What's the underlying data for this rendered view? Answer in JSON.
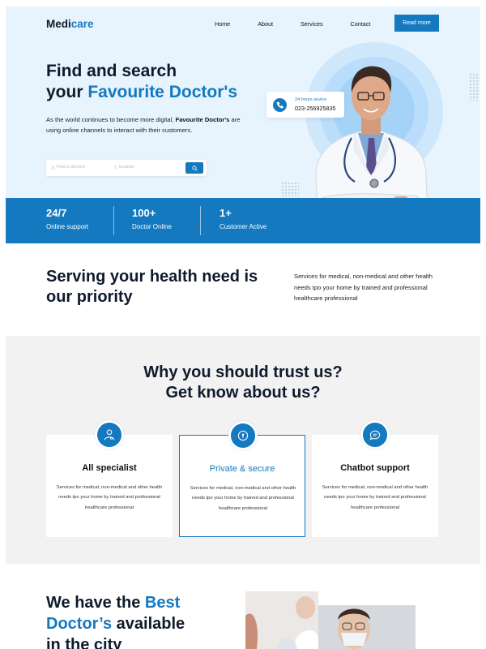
{
  "brand": {
    "name_part1": "Medi",
    "name_part2": "care"
  },
  "nav": {
    "items": [
      "Home",
      "About",
      "Services",
      "Contact"
    ],
    "cta": "Read more"
  },
  "hero": {
    "title_line1": "Find and search",
    "title_line2_plain": "your ",
    "title_line2_accent": "Favourite Doctor's",
    "desc_part1": "As the world continues to become more digital, ",
    "desc_bold": "Favourite Doctor's",
    "desc_part2": " are using online channels to interact with their customers.",
    "search": {
      "doctor_placeholder": "Find a doctors",
      "location_placeholder": "location"
    }
  },
  "support": {
    "title": "24 hours sevice",
    "phone": "023-256925835"
  },
  "stats": [
    {
      "value": "24/7",
      "label": "Online support"
    },
    {
      "value": "100+",
      "label": "Doctor Online"
    },
    {
      "value": "1+",
      "label": "Customer Active"
    }
  ],
  "serving": {
    "title": "Serving your health need is our priority",
    "desc": "Services for medical, non-medical and other health needs tpo your home by trained and professional healthcare professional"
  },
  "trust": {
    "title_line1": "Why you should trust us?",
    "title_line2": "Get know about us?",
    "cards": [
      {
        "title": "All specialist",
        "desc": "Services for medical, non-medical and other health needs tpo your home by trained and professional healthcare professional",
        "icon": "doctor-icon"
      },
      {
        "title": "Private & secure",
        "desc": "Services for medical, non-medical and other health needs tpo your home by trained and professional healthcare professional",
        "icon": "lock-icon"
      },
      {
        "title": "Chatbot support",
        "desc": "Services for medical, non-medical and other health needs tpo your home by trained and professional healthcare professional",
        "icon": "chat-icon"
      }
    ]
  },
  "best": {
    "line1_plain": "We have the ",
    "line1_accent": "Best",
    "line2_accent": "Doctor’s",
    "line2_plain": " available",
    "line3": "in the city"
  },
  "colors": {
    "accent": "#1579c0",
    "hero_bg": "#e7f3fd",
    "section_bg": "#f2f2f2"
  }
}
